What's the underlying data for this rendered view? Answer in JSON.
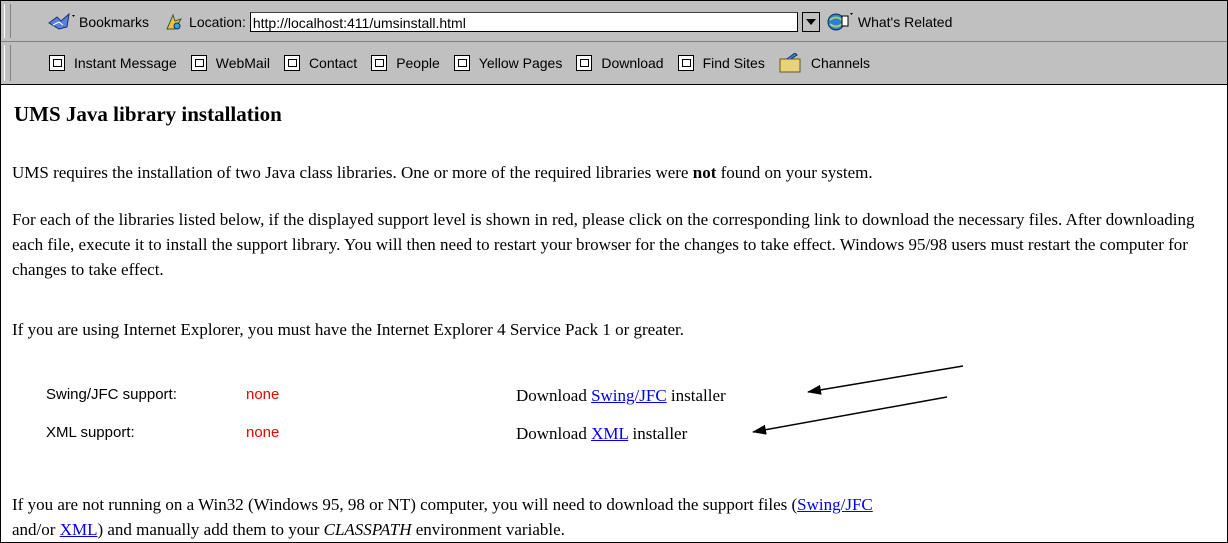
{
  "toolbar": {
    "bookmarks_label": "Bookmarks",
    "location_label": "Location:",
    "url": "http://localhost:411/umsinstall.html",
    "whats_related_label": "What's Related"
  },
  "personal_bar": {
    "items": [
      {
        "label": "Instant Message",
        "icon": "bookmark-doc-icon"
      },
      {
        "label": "WebMail",
        "icon": "bookmark-doc-icon"
      },
      {
        "label": "Contact",
        "icon": "bookmark-doc-icon"
      },
      {
        "label": "People",
        "icon": "bookmark-doc-icon"
      },
      {
        "label": "Yellow Pages",
        "icon": "bookmark-doc-icon"
      },
      {
        "label": "Download",
        "icon": "bookmark-doc-icon"
      },
      {
        "label": "Find Sites",
        "icon": "bookmark-doc-icon"
      },
      {
        "label": "Channels",
        "icon": "channels-folder-icon"
      }
    ]
  },
  "page": {
    "title": "UMS Java library installation",
    "p1_before": "UMS requires the installation of two Java class libraries. One or more of the required libraries were ",
    "p1_bold": "not",
    "p1_after": " found on your system.",
    "p2": "For each of the libraries listed below, if the displayed support level is shown in red, please click on the corresponding link to download the necessary files. After downloading each file, execute it to install the support library. You will then need to restart your browser for the changes to take effect. Windows 95/98 users must restart the computer for changes to take effect.",
    "p3": "If you are using Internet Explorer, you must have the Internet Explorer 4 Service Pack 1 or greater.",
    "libraries": [
      {
        "label": "Swing/JFC support:",
        "level": "none",
        "download_prefix": "Download ",
        "link": "Swing/JFC",
        "download_suffix": " installer"
      },
      {
        "label": "XML support:",
        "level": "none",
        "download_prefix": "Download ",
        "link": "XML",
        "download_suffix": " installer"
      }
    ],
    "p4_a": "If you are not running on a Win32 (Windows 95, 98 or NT) computer, you will need to download the support files (",
    "p4_link1": "Swing/JFC",
    "p4_b": "",
    "p4_c": "and/or ",
    "p4_link2": "XML",
    "p4_d": ") and manually add them to your ",
    "p4_em": "CLASSPATH",
    "p4_e": " environment variable."
  },
  "colors": {
    "chrome": "#c0c0c0",
    "link": "#0000ee",
    "alert": "#ee0000"
  }
}
